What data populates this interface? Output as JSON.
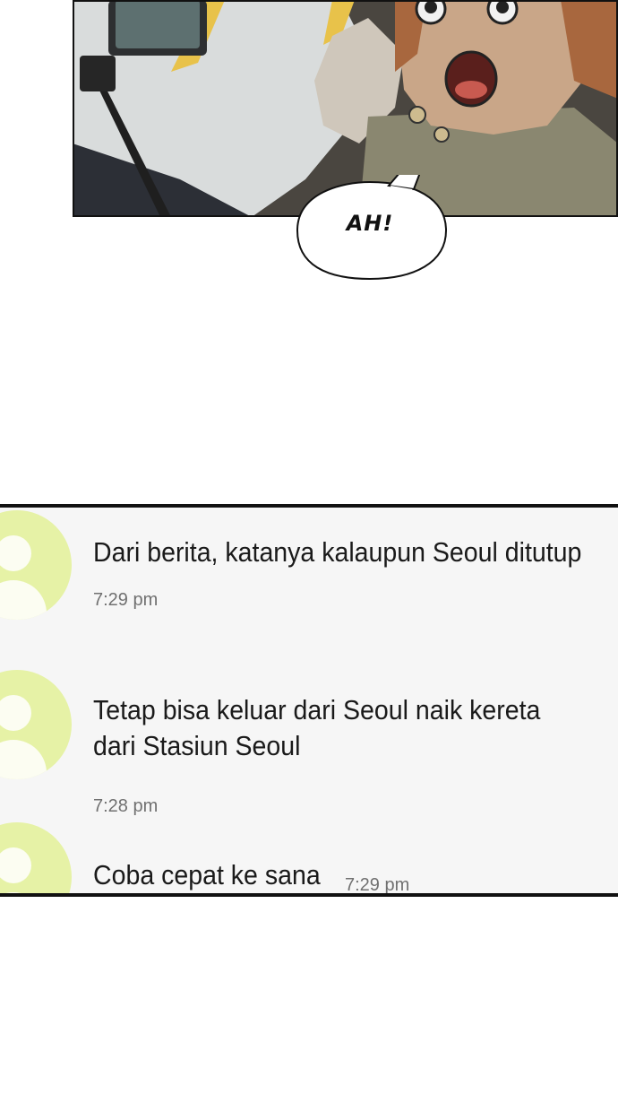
{
  "speech_bubble": {
    "text": "AH!"
  },
  "chat": {
    "messages": [
      {
        "lines": [
          "Dari berita, katanya kalaupun Seoul ditutup"
        ],
        "time": "7:29 pm"
      },
      {
        "lines": [
          "Tetap bisa keluar dari Seoul naik kereta",
          "dari Stasiun Seoul"
        ],
        "time": "7:28 pm"
      },
      {
        "lines": [
          "Coba cepat ke sana"
        ],
        "time": "7:29 pm"
      }
    ]
  },
  "colors": {
    "avatar_bg": "#e6f2a6",
    "chat_bg": "#f6f6f6",
    "border": "#111111"
  }
}
